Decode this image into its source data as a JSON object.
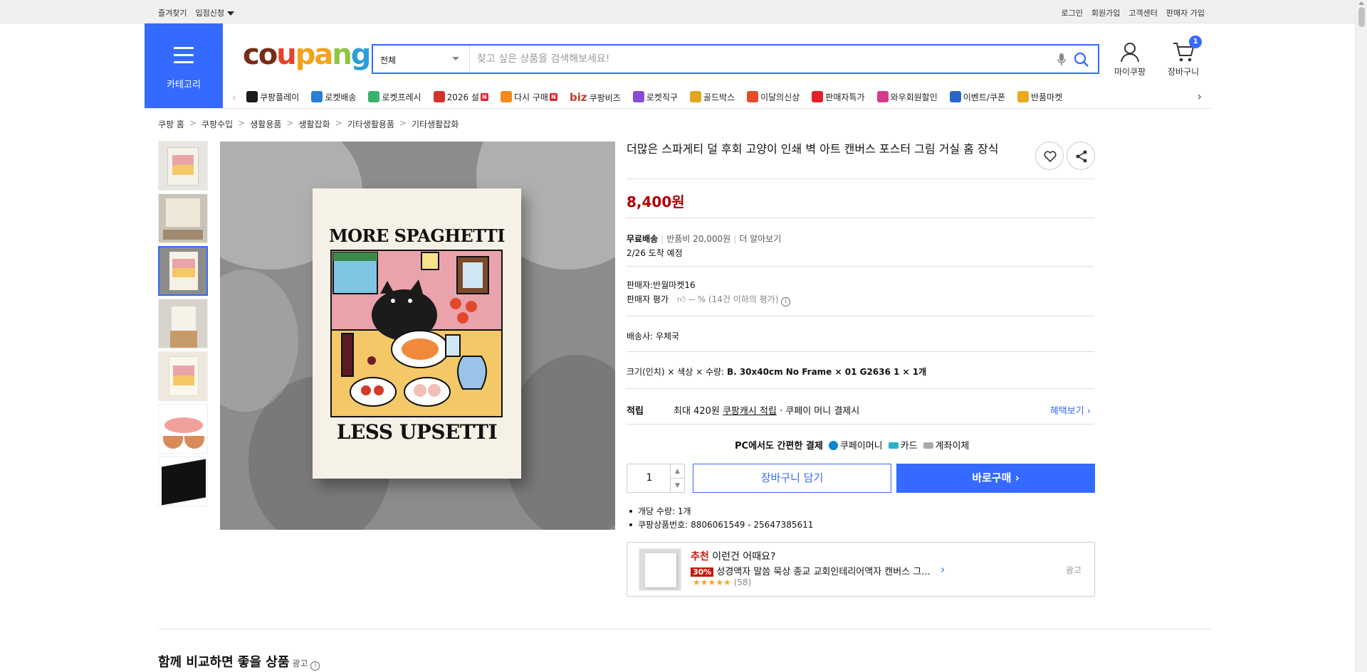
{
  "topbar": {
    "left": [
      "즐겨찾기",
      "입점신청"
    ],
    "right": [
      "로그인",
      "회원가입",
      "고객센터",
      "판매자 가입"
    ]
  },
  "header": {
    "category_label": "카테고리",
    "logo": "coupang",
    "search_scope": "전체",
    "search_placeholder": "찾고 싶은 상품을 검색해보세요!",
    "mycoupang": "마이쿠팡",
    "cart": "장바구니",
    "cart_count": "1"
  },
  "nav": {
    "items": [
      {
        "label": "쿠팡플레이",
        "icon": "coupang-play-icon",
        "color": "#1b1b1b"
      },
      {
        "label": "로켓배송",
        "icon": "rocket-icon",
        "color": "#2a7dd8"
      },
      {
        "label": "로켓프레시",
        "icon": "rocket-fresh-icon",
        "color": "#3bb26b"
      },
      {
        "label": "2026 설",
        "icon": "new-year-icon",
        "color": "#d0342c",
        "badge": "N"
      },
      {
        "label": "다시 구매",
        "icon": "rebuy-icon",
        "color": "#f38a1d",
        "badge": "N"
      },
      {
        "label": "쿠팡비즈",
        "prefix": "biz",
        "icon": "biz-icon",
        "color": "#b8432e"
      },
      {
        "label": "로켓직구",
        "icon": "rocket-direct-icon",
        "color": "#8a4ad6"
      },
      {
        "label": "골드박스",
        "icon": "goldbox-icon",
        "color": "#e0a622"
      },
      {
        "label": "이달의신상",
        "icon": "new-arrival-icon",
        "color": "#e84a2b"
      },
      {
        "label": "판매자특가",
        "icon": "seller-deal-icon",
        "color": "#e4202a"
      },
      {
        "label": "와우회원할인",
        "icon": "wow-icon",
        "color": "#d63a8a"
      },
      {
        "label": "이벤트/쿠폰",
        "icon": "coupon-icon",
        "color": "#2a66c9"
      },
      {
        "label": "반품마켓",
        "icon": "return-market-icon",
        "color": "#e9a91c"
      }
    ]
  },
  "breadcrumb": [
    "쿠팡 홈",
    "쿠팡수입",
    "생활용품",
    "생활잡화",
    "기타생활용품",
    "기타생활잡화"
  ],
  "product": {
    "title": "더많은 스파게티 덜 후회 고양이 인쇄 벽 아트 캔버스 포스터 그림 거실 홈 장식",
    "price": "8,400원",
    "shipping_free": "무료배송",
    "return_fee": "반품비 20,000원",
    "more": "더 알아보기",
    "arrival": "2/26 도착 예정",
    "seller": "판매자:반월마켓16",
    "seller_rating_label": "판매자 평가",
    "seller_rating_value": "-- % (14건 이하의 평가)",
    "carrier": "배송사:  우체국",
    "option_label": "크기(인치) × 색상 × 수량:",
    "option_value": "B. 30x40cm No Frame × 01 G2636 1 × 1개",
    "reward_key": "적립",
    "reward_text_1": "최대 420원",
    "reward_text_2": "쿠팡캐시 적립",
    "reward_text_3": "· 쿠페이 머니 결제시",
    "reward_more": "혜택보기 ›",
    "pay_label": "PC에서도 간편한 결제",
    "pay_options": [
      "쿠페이머니",
      "카드",
      "계좌이체"
    ],
    "quantity": "1",
    "cart_button": "장바구니 담기",
    "buy_button": "바로구매 ›",
    "details": [
      "개당 수량: 1개",
      "쿠팡상품번호: 8806061549 - 25647385611"
    ],
    "poster_top": "MORE SPAGHETTI",
    "poster_bottom": "LESS UPSETTI"
  },
  "recommendation": {
    "prefix": "추천",
    "heading": "이런건 어때요?",
    "discount": "30%",
    "name": "성경액자 말씀 묵상 종교 교회인테리어액자 캔버스 그...",
    "reviews": "(58)",
    "ad": "광고"
  },
  "section": {
    "title": "함께 비교하면 좋을 상품",
    "ad": "광고"
  }
}
